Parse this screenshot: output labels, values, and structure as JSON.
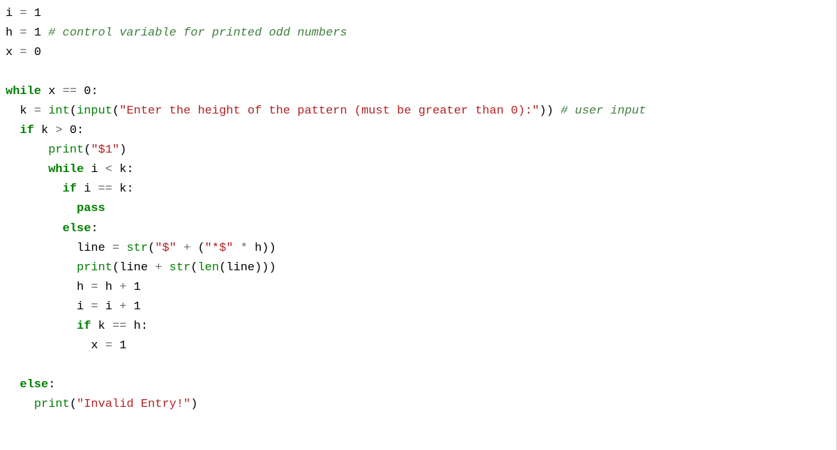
{
  "code": {
    "lines": [
      [
        {
          "t": "i ",
          "c": "tok-default"
        },
        {
          "t": "=",
          "c": "tok-op"
        },
        {
          "t": " ",
          "c": "tok-default"
        },
        {
          "t": "1",
          "c": "tok-number"
        }
      ],
      [
        {
          "t": "h ",
          "c": "tok-default"
        },
        {
          "t": "=",
          "c": "tok-op"
        },
        {
          "t": " ",
          "c": "tok-default"
        },
        {
          "t": "1",
          "c": "tok-number"
        },
        {
          "t": " ",
          "c": "tok-default"
        },
        {
          "t": "# control variable for printed odd numbers",
          "c": "tok-comment"
        }
      ],
      [
        {
          "t": "x ",
          "c": "tok-default"
        },
        {
          "t": "=",
          "c": "tok-op"
        },
        {
          "t": " ",
          "c": "tok-default"
        },
        {
          "t": "0",
          "c": "tok-number"
        }
      ],
      [
        {
          "t": "",
          "c": "tok-default"
        }
      ],
      [
        {
          "t": "while",
          "c": "tok-keyword"
        },
        {
          "t": " x ",
          "c": "tok-default"
        },
        {
          "t": "==",
          "c": "tok-op"
        },
        {
          "t": " ",
          "c": "tok-default"
        },
        {
          "t": "0",
          "c": "tok-number"
        },
        {
          "t": ":",
          "c": "tok-default"
        }
      ],
      [
        {
          "t": "  k ",
          "c": "tok-default"
        },
        {
          "t": "=",
          "c": "tok-op"
        },
        {
          "t": " ",
          "c": "tok-default"
        },
        {
          "t": "int",
          "c": "tok-builtin"
        },
        {
          "t": "(",
          "c": "tok-default"
        },
        {
          "t": "input",
          "c": "tok-builtin"
        },
        {
          "t": "(",
          "c": "tok-default"
        },
        {
          "t": "\"Enter the height of the pattern (must be greater than 0):\"",
          "c": "tok-string"
        },
        {
          "t": ")) ",
          "c": "tok-default"
        },
        {
          "t": "# user input",
          "c": "tok-comment"
        }
      ],
      [
        {
          "t": "  ",
          "c": "tok-default"
        },
        {
          "t": "if",
          "c": "tok-keyword"
        },
        {
          "t": " k ",
          "c": "tok-default"
        },
        {
          "t": ">",
          "c": "tok-op"
        },
        {
          "t": " ",
          "c": "tok-default"
        },
        {
          "t": "0",
          "c": "tok-number"
        },
        {
          "t": ":",
          "c": "tok-default"
        }
      ],
      [
        {
          "t": "      ",
          "c": "tok-default"
        },
        {
          "t": "print",
          "c": "tok-builtin"
        },
        {
          "t": "(",
          "c": "tok-default"
        },
        {
          "t": "\"$1\"",
          "c": "tok-string"
        },
        {
          "t": ")",
          "c": "tok-default"
        }
      ],
      [
        {
          "t": "      ",
          "c": "tok-default"
        },
        {
          "t": "while",
          "c": "tok-keyword"
        },
        {
          "t": " i ",
          "c": "tok-default"
        },
        {
          "t": "<",
          "c": "tok-op"
        },
        {
          "t": " k:",
          "c": "tok-default"
        }
      ],
      [
        {
          "t": "        ",
          "c": "tok-default"
        },
        {
          "t": "if",
          "c": "tok-keyword"
        },
        {
          "t": " i ",
          "c": "tok-default"
        },
        {
          "t": "==",
          "c": "tok-op"
        },
        {
          "t": " k:",
          "c": "tok-default"
        }
      ],
      [
        {
          "t": "          ",
          "c": "tok-default"
        },
        {
          "t": "pass",
          "c": "tok-keyword"
        }
      ],
      [
        {
          "t": "        ",
          "c": "tok-default"
        },
        {
          "t": "else",
          "c": "tok-keyword"
        },
        {
          "t": ":",
          "c": "tok-default"
        }
      ],
      [
        {
          "t": "          line ",
          "c": "tok-default"
        },
        {
          "t": "=",
          "c": "tok-op"
        },
        {
          "t": " ",
          "c": "tok-default"
        },
        {
          "t": "str",
          "c": "tok-builtin"
        },
        {
          "t": "(",
          "c": "tok-default"
        },
        {
          "t": "\"$\"",
          "c": "tok-string"
        },
        {
          "t": " ",
          "c": "tok-default"
        },
        {
          "t": "+",
          "c": "tok-op"
        },
        {
          "t": " (",
          "c": "tok-default"
        },
        {
          "t": "\"*$\"",
          "c": "tok-string"
        },
        {
          "t": " ",
          "c": "tok-default"
        },
        {
          "t": "*",
          "c": "tok-op"
        },
        {
          "t": " h))",
          "c": "tok-default"
        }
      ],
      [
        {
          "t": "          ",
          "c": "tok-default"
        },
        {
          "t": "print",
          "c": "tok-builtin"
        },
        {
          "t": "(line ",
          "c": "tok-default"
        },
        {
          "t": "+",
          "c": "tok-op"
        },
        {
          "t": " ",
          "c": "tok-default"
        },
        {
          "t": "str",
          "c": "tok-builtin"
        },
        {
          "t": "(",
          "c": "tok-default"
        },
        {
          "t": "len",
          "c": "tok-builtin"
        },
        {
          "t": "(line)))",
          "c": "tok-default"
        }
      ],
      [
        {
          "t": "          h ",
          "c": "tok-default"
        },
        {
          "t": "=",
          "c": "tok-op"
        },
        {
          "t": " h ",
          "c": "tok-default"
        },
        {
          "t": "+",
          "c": "tok-op"
        },
        {
          "t": " ",
          "c": "tok-default"
        },
        {
          "t": "1",
          "c": "tok-number"
        }
      ],
      [
        {
          "t": "          i ",
          "c": "tok-default"
        },
        {
          "t": "=",
          "c": "tok-op"
        },
        {
          "t": " i ",
          "c": "tok-default"
        },
        {
          "t": "+",
          "c": "tok-op"
        },
        {
          "t": " ",
          "c": "tok-default"
        },
        {
          "t": "1",
          "c": "tok-number"
        }
      ],
      [
        {
          "t": "          ",
          "c": "tok-default"
        },
        {
          "t": "if",
          "c": "tok-keyword"
        },
        {
          "t": " k ",
          "c": "tok-default"
        },
        {
          "t": "==",
          "c": "tok-op"
        },
        {
          "t": " h:",
          "c": "tok-default"
        }
      ],
      [
        {
          "t": "            x ",
          "c": "tok-default"
        },
        {
          "t": "=",
          "c": "tok-op"
        },
        {
          "t": " ",
          "c": "tok-default"
        },
        {
          "t": "1",
          "c": "tok-number"
        }
      ],
      [
        {
          "t": "",
          "c": "tok-default"
        }
      ],
      [
        {
          "t": "  ",
          "c": "tok-default"
        },
        {
          "t": "else",
          "c": "tok-keyword"
        },
        {
          "t": ":",
          "c": "tok-default"
        }
      ],
      [
        {
          "t": "    ",
          "c": "tok-default"
        },
        {
          "t": "print",
          "c": "tok-builtin"
        },
        {
          "t": "(",
          "c": "tok-default"
        },
        {
          "t": "\"Invalid Entry!\"",
          "c": "tok-string"
        },
        {
          "t": ")",
          "c": "tok-default"
        }
      ]
    ]
  }
}
